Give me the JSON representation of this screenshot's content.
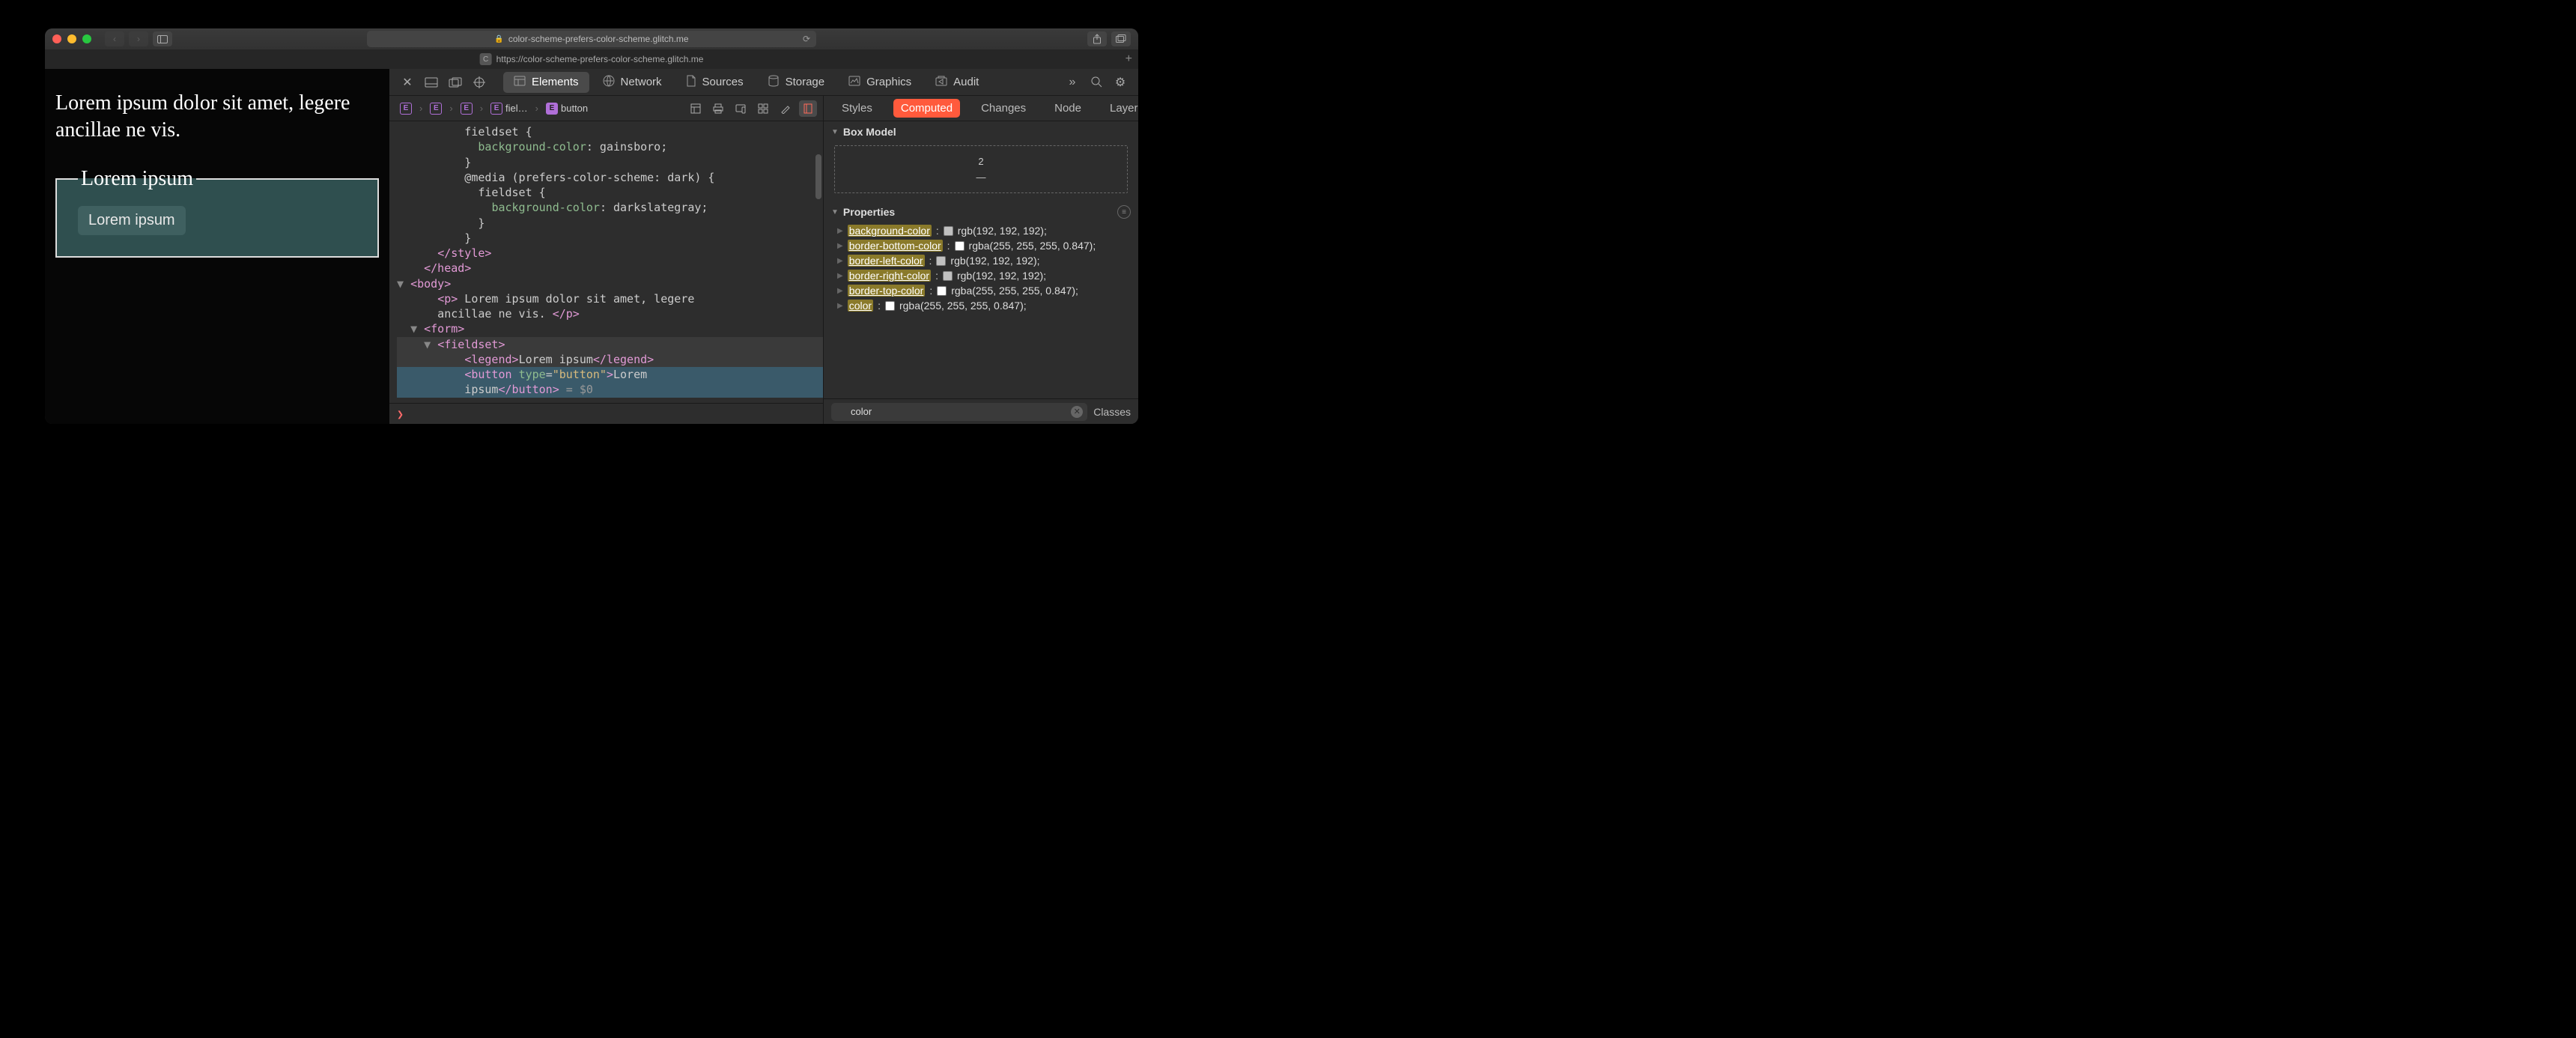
{
  "titlebar": {
    "url_display": "color-scheme-prefers-color-scheme.glitch.me"
  },
  "tab": {
    "title": "https://color-scheme-prefers-color-scheme.glitch.me"
  },
  "page": {
    "paragraph": "Lorem ipsum dolor sit amet, legere ancillae ne vis.",
    "legend": "Lorem ipsum",
    "button": "Lorem ipsum"
  },
  "devtools": {
    "tabs": [
      "Elements",
      "Network",
      "Sources",
      "Storage",
      "Graphics",
      "Audit"
    ],
    "active_tab": "Elements",
    "breadcrumb": [
      {
        "tag": "E",
        "name": ""
      },
      {
        "tag": "E",
        "name": ""
      },
      {
        "tag": "E",
        "name": ""
      },
      {
        "tag": "E",
        "name": "fiel…"
      },
      {
        "tag": "E",
        "name": "button",
        "selected": true
      }
    ],
    "dom_lines": [
      {
        "indent": 10,
        "html": "fieldset {"
      },
      {
        "indent": 12,
        "html": "<span class='gr'>background-color</span>: gainsboro;"
      },
      {
        "indent": 10,
        "html": "}"
      },
      {
        "indent": 10,
        "html": "@media (prefers-color-scheme: dark) {"
      },
      {
        "indent": 12,
        "html": "fieldset {"
      },
      {
        "indent": 14,
        "html": "<span class='gr'>background-color</span>: darkslategray;"
      },
      {
        "indent": 12,
        "html": "}"
      },
      {
        "indent": 10,
        "html": "}"
      },
      {
        "indent": 6,
        "html": "<span class='pk'>&lt;/style&gt;</span>"
      },
      {
        "indent": 4,
        "html": "<span class='pk'>&lt;/head&gt;</span>"
      },
      {
        "indent": 2,
        "tri": true,
        "html": "<span class='pk'>&lt;body&gt;</span>"
      },
      {
        "indent": 6,
        "html": "<span class='pk'>&lt;p&gt;</span> Lorem ipsum dolor sit amet, legere"
      },
      {
        "indent": 6,
        "html": "ancillae ne vis. <span class='pk'>&lt;/p&gt;</span>"
      },
      {
        "indent": 4,
        "tri": true,
        "html": "<span class='pk'>&lt;form&gt;</span>"
      },
      {
        "indent": 6,
        "tri": true,
        "html": "<span class='pk'>&lt;fieldset&gt;</span>",
        "cls": "hl"
      },
      {
        "indent": 10,
        "html": "<span class='pk'>&lt;legend&gt;</span>Lorem ipsum<span class='pk'>&lt;/legend&gt;</span>",
        "cls": "hl"
      },
      {
        "indent": 10,
        "html": "<span class='pk'>&lt;button</span> <span class='gr'>type</span>=<span class='or'>\"button\"</span><span class='pk'>&gt;</span>Lorem",
        "cls": "sel"
      },
      {
        "indent": 10,
        "html": "ipsum<span class='pk'>&lt;/button&gt;</span> <span class='gray'>= $0</span>",
        "cls": "sel"
      }
    ],
    "console_prompt": "❯"
  },
  "sidebar": {
    "tabs": [
      "Styles",
      "Computed",
      "Changes",
      "Node",
      "Layers"
    ],
    "active": "Computed",
    "box_model_label": "Box Model",
    "box_top": "2",
    "box_bottom": "—",
    "properties_label": "Properties",
    "props": [
      {
        "name": "background-color",
        "swatch": "#c0c0c0",
        "value": "rgb(192, 192, 192)"
      },
      {
        "name": "border-bottom-color",
        "swatch": "#ffffff",
        "value": "rgba(255, 255, 255, 0.847)"
      },
      {
        "name": "border-left-color",
        "swatch": "#c0c0c0",
        "value": "rgb(192, 192, 192)"
      },
      {
        "name": "border-right-color",
        "swatch": "#c0c0c0",
        "value": "rgb(192, 192, 192)"
      },
      {
        "name": "border-top-color",
        "swatch": "#ffffff",
        "value": "rgba(255, 255, 255, 0.847)"
      },
      {
        "name": "color",
        "swatch": "#ffffff",
        "value": "rgba(255, 255, 255, 0.847)"
      }
    ],
    "filter_value": "color",
    "classes_label": "Classes"
  }
}
